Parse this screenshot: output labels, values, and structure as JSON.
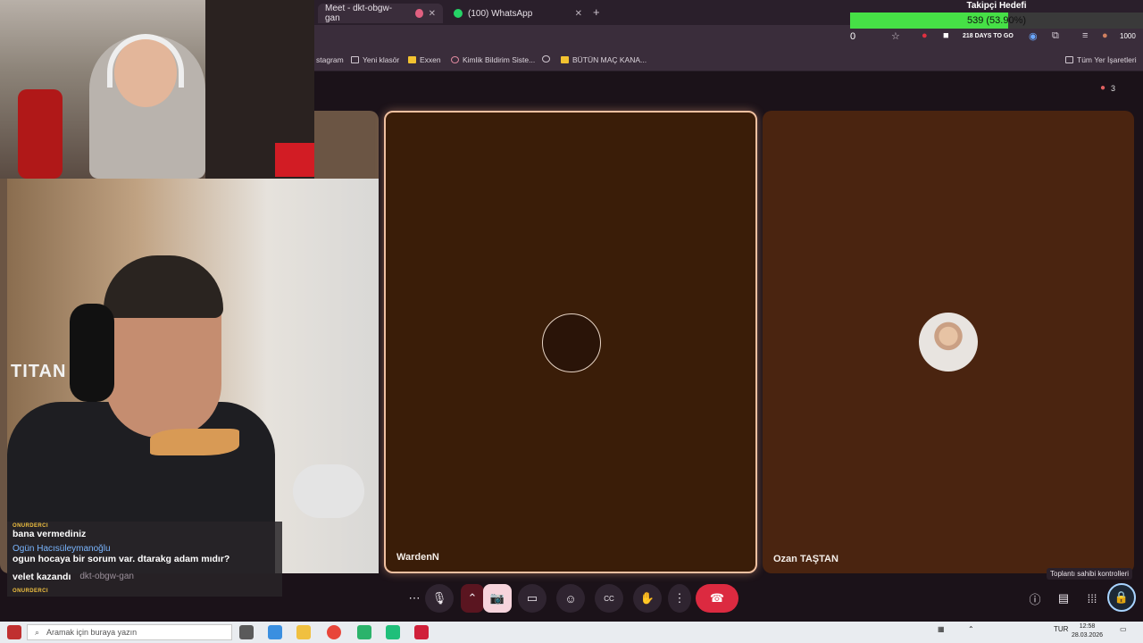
{
  "browser": {
    "tabs": [
      {
        "title": "Meet - dkt-obgw-gan",
        "active": true
      },
      {
        "title": "(100) WhatsApp",
        "active": false
      }
    ],
    "bookmarks": [
      {
        "label": "stagram",
        "icon": "instagram-icon"
      },
      {
        "label": "Yeni klasör",
        "icon": "folder-icon"
      },
      {
        "label": "Exxen",
        "icon": "exxen-icon"
      },
      {
        "label": "Kimlik Bildirim Siste...",
        "icon": "bookmark-icon"
      },
      {
        "label": "",
        "icon": "globe-icon"
      },
      {
        "label": "BÜTÜN MAÇ KANA...",
        "icon": "jp-icon"
      },
      {
        "label": "Tüm Yer İşaretleri",
        "icon": "folder-icon"
      }
    ],
    "address_counter": "0",
    "extension_text": "218 DAYS TO GO",
    "extension_count": "1000"
  },
  "follower_goal": {
    "title": "Takipçi Hedefi",
    "progress_text": "539 (53.90%)",
    "progress_fraction": 0.539,
    "fill_color": "#46e046"
  },
  "meet": {
    "participants_count": "3",
    "tiles": [
      {
        "name": "WardenN"
      },
      {
        "name": "Ozan TAŞTAN"
      }
    ],
    "host_controls_tooltip": "Toplantı sahibi kontrolleri",
    "meeting_code": "dkt-obgw-gan",
    "controls": {
      "more_options": "⋯",
      "mic": "🎙",
      "camera_off": "📷",
      "present": "▭",
      "emoji": "☺",
      "captions": "CC",
      "raise_hand": "✋",
      "more": "⋮",
      "end_call": "☎"
    }
  },
  "cam": {
    "brand_text": "TITAN"
  },
  "chat": [
    {
      "user": "ONURDERCI",
      "message": "bana vermediniz"
    },
    {
      "user": "Ogün Hacısüleymanoğlu",
      "message": "ogun hocaya bir sorum var. dtarakg adam mıdır?"
    },
    {
      "user": "",
      "message": "velet kazandı"
    },
    {
      "user": "ONURDERCI",
      "message": ""
    }
  ],
  "taskbar": {
    "search_placeholder": "Aramak için buraya yazın",
    "language": "TUR",
    "time": "12:58",
    "date": "28.03.2026"
  }
}
